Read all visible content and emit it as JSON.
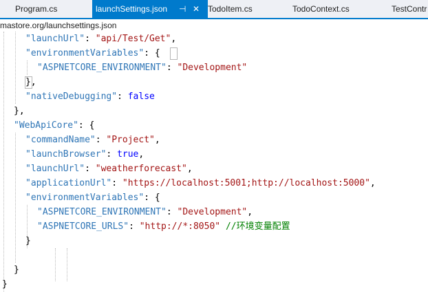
{
  "tabs": [
    {
      "label": "Program.cs",
      "active": false
    },
    {
      "label": "launchSettings.json",
      "active": true
    },
    {
      "label": "TodoItem.cs",
      "active": false
    },
    {
      "label": "TodoContext.cs",
      "active": false
    },
    {
      "label": "TestContr",
      "active": false
    }
  ],
  "tab_icons": {
    "pin": "⊣",
    "close": "✕"
  },
  "path": "mastore.org/launchsettings.json",
  "colors": {
    "key": "#2e75b6",
    "string": "#a31515",
    "keyword": "#0000ff",
    "punct": "#000000",
    "comment": "#008000"
  },
  "lines": [
    [
      {
        "t": "\"launchUrl\"",
        "c": "key"
      },
      {
        "t": ": ",
        "c": "punct"
      },
      {
        "t": "\"api/Test/Get\"",
        "c": "string"
      },
      {
        "t": ",",
        "c": "punct"
      }
    ],
    [
      {
        "t": "\"environmentVariables\"",
        "c": "key"
      },
      {
        "t": ": ",
        "c": "punct"
      },
      {
        "t": "{",
        "c": "punct"
      }
    ],
    [
      {
        "t": "\"ASPNETCORE_ENVIRONMENT\"",
        "c": "key"
      },
      {
        "t": ": ",
        "c": "punct"
      },
      {
        "t": "\"Development\"",
        "c": "string"
      }
    ],
    [
      {
        "t": "},",
        "c": "punct"
      }
    ],
    [
      {
        "t": "\"nativeDebugging\"",
        "c": "key"
      },
      {
        "t": ": ",
        "c": "punct"
      },
      {
        "t": "false",
        "c": "keyword"
      }
    ],
    [
      {
        "t": "},",
        "c": "punct"
      }
    ],
    [
      {
        "t": "\"WebApiCore\"",
        "c": "key"
      },
      {
        "t": ": {",
        "c": "punct"
      }
    ],
    [
      {
        "t": "\"commandName\"",
        "c": "key"
      },
      {
        "t": ": ",
        "c": "punct"
      },
      {
        "t": "\"Project\"",
        "c": "string"
      },
      {
        "t": ",",
        "c": "punct"
      }
    ],
    [
      {
        "t": "\"launchBrowser\"",
        "c": "key"
      },
      {
        "t": ": ",
        "c": "punct"
      },
      {
        "t": "true",
        "c": "keyword"
      },
      {
        "t": ",",
        "c": "punct"
      }
    ],
    [
      {
        "t": "\"launchUrl\"",
        "c": "key"
      },
      {
        "t": ": ",
        "c": "punct"
      },
      {
        "t": "\"weatherforecast\"",
        "c": "string"
      },
      {
        "t": ",",
        "c": "punct"
      }
    ],
    [
      {
        "t": "\"applicationUrl\"",
        "c": "key"
      },
      {
        "t": ": ",
        "c": "punct"
      },
      {
        "t": "\"https://localhost:5001;http://localhost:5000\"",
        "c": "string"
      },
      {
        "t": ",",
        "c": "punct"
      }
    ],
    [
      {
        "t": "\"environmentVariables\"",
        "c": "key"
      },
      {
        "t": ": {",
        "c": "punct"
      }
    ],
    [
      {
        "t": "\"ASPNETCORE_ENVIRONMENT\"",
        "c": "key"
      },
      {
        "t": ": ",
        "c": "punct"
      },
      {
        "t": "\"Development\"",
        "c": "string"
      },
      {
        "t": ",",
        "c": "punct"
      }
    ],
    [
      {
        "t": "\"ASPNETCORE_URLS\"",
        "c": "key"
      },
      {
        "t": ": ",
        "c": "punct"
      },
      {
        "t": "\"http://*:8050\"",
        "c": "string"
      },
      {
        "t": " ",
        "c": "punct"
      },
      {
        "t": "//环境变量配置",
        "c": "comment"
      }
    ],
    [
      {
        "t": "}",
        "c": "punct"
      }
    ],
    [],
    [
      {
        "t": "}",
        "c": "punct"
      }
    ],
    [
      {
        "t": "}",
        "c": "punct"
      }
    ]
  ]
}
